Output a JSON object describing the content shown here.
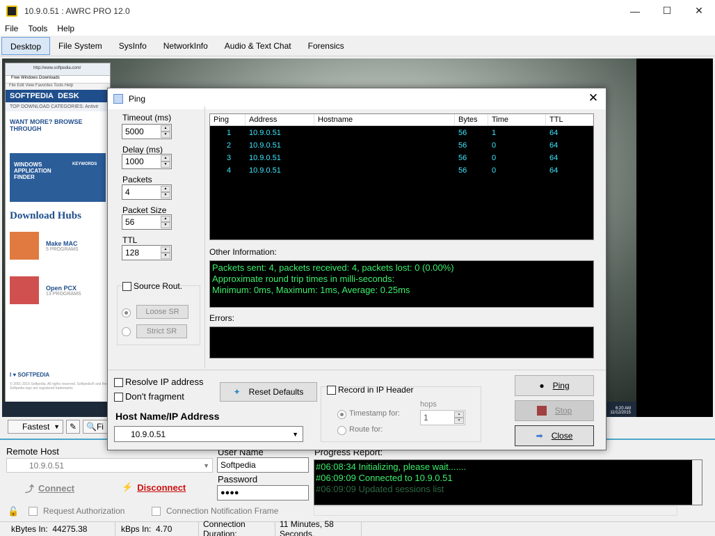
{
  "window": {
    "title": "10.9.0.51 : AWRC PRO 12.0"
  },
  "menu": [
    "File",
    "Tools",
    "Help"
  ],
  "tabs": [
    "Desktop",
    "File System",
    "SysInfo",
    "NetworkInfo",
    "Audio & Text Chat",
    "Forensics"
  ],
  "remote_screen": {
    "browser_url": "http://www.softpedia.com/",
    "browser_tab": "Free Windows Downloads",
    "browser_menu": "File   Edit   View   Favorites   Tools   Help",
    "logo": "SOFTPEDIA",
    "logo_suffix": "DESK",
    "top_categories": "TOP DOWNLOAD CATEGORIES:",
    "top_categories_item": "Antivir",
    "want_more": "WANT MORE? BROWSE THROUGH",
    "banner": "WINDOWS APPLICATION FINDER",
    "banner_keywords": "KEYWORDS",
    "hubs_title": "Download Hubs",
    "hubs": [
      {
        "name": "Make MAC",
        "sub": "5 PROGRAMS"
      },
      {
        "name": "Open PCX",
        "sub": "13 PROGRAMS"
      }
    ],
    "footer": "I ♥ SOFTPEDIA",
    "copyright": "© 2001-2015 Softpedia. All rights reserved. Softpedia® and the Softpedia logo are registered trademarks",
    "clock": "6:20 AM\n11/12/2015"
  },
  "toolstrip": {
    "quality": "Fastest",
    "fit_label": "Fi"
  },
  "bottom": {
    "remote_host_label": "Remote Host",
    "remote_host_value": "10.9.0.51",
    "connect": "Connect",
    "disconnect": "Disconnect",
    "request_auth": "Request Authorization",
    "conn_notif": "Connection Notification Frame",
    "username_label": "User Name",
    "username_value": "Softpedia",
    "password_label": "Password",
    "password_value": "●●●●",
    "progress_label": "Progress Report:",
    "progress_lines": [
      "#06:08:34 Initializing, please wait.......",
      "#06:09:09 Connected to 10.9.0.51",
      "#06:09:09 Updated sessions list"
    ]
  },
  "status": {
    "kbytes_in_label": "kBytes In:",
    "kbytes_in_value": "44275.38",
    "kbps_in_label": "kBps In:",
    "kbps_in_value": "4.70",
    "duration_label": "Connection Duration:",
    "duration_value": "11 Minutes, 58 Seconds."
  },
  "ping_dialog": {
    "title": "Ping",
    "timeout_label": "Timeout (ms)",
    "timeout": "5000",
    "delay_label": "Delay (ms)",
    "delay": "1000",
    "packets_label": "Packets",
    "packets": "4",
    "packet_size_label": "Packet Size",
    "packet_size": "56",
    "ttl_label": "TTL",
    "ttl": "128",
    "source_route": "Source Rout.",
    "loose_sr": "Loose SR",
    "strict_sr": "Strict SR",
    "columns": [
      "Ping",
      "Address",
      "Hostname",
      "Bytes",
      "Time",
      "TTL"
    ],
    "rows": [
      [
        "1",
        "10.9.0.51",
        "",
        "56",
        "1",
        "64"
      ],
      [
        "2",
        "10.9.0.51",
        "",
        "56",
        "0",
        "64"
      ],
      [
        "3",
        "10.9.0.51",
        "",
        "56",
        "0",
        "64"
      ],
      [
        "4",
        "10.9.0.51",
        "",
        "56",
        "0",
        "64"
      ]
    ],
    "other_info_label": "Other Information:",
    "other_info": [
      "Packets sent: 4, packets received: 4, packets lost: 0 (0.00%)",
      "Approximate round trip times in milli-seconds:",
      "Minimum: 0ms, Maximum: 1ms, Average: 0.25ms"
    ],
    "errors_label": "Errors:",
    "resolve_ip": "Resolve IP address",
    "dont_fragment": "Don't fragment",
    "reset_defaults": "Reset Defaults",
    "record_ip_header": "Record in IP Header",
    "hops_label": "hops",
    "timestamp_for": "Timestamp for:",
    "route_for": "Route for:",
    "hops_value": "1",
    "host_label": "Host Name/IP Address",
    "host_value": "10.9.0.51",
    "ping_btn": "Ping",
    "stop_btn": "Stop",
    "close_btn": "Close"
  },
  "colors": {
    "accent": "#4aa6c8",
    "terminal_green": "#3cf06c",
    "terminal_cyan": "#3de8ff",
    "disconnect_red": "#cc1010"
  }
}
